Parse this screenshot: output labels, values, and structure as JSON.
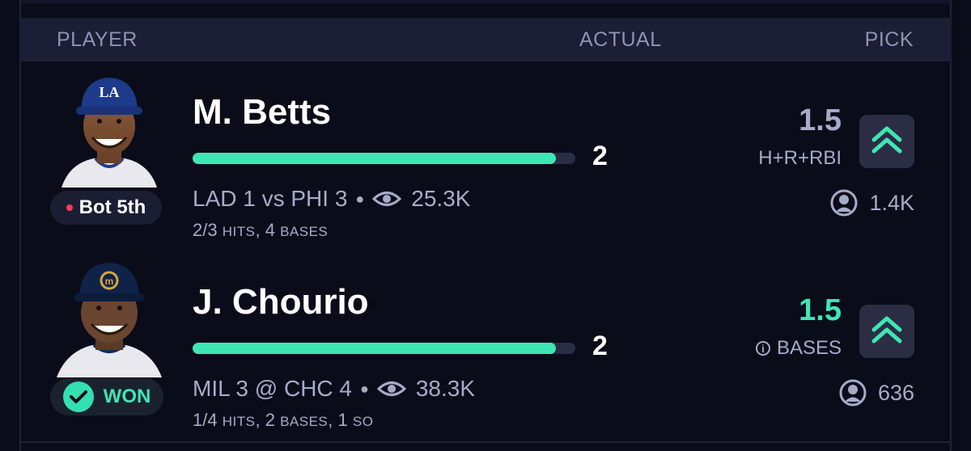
{
  "header": {
    "player": "PLAYER",
    "actual": "ACTUAL",
    "pick": "PICK"
  },
  "colors": {
    "accent": "#3ee6b4",
    "live_dot": "#ff3b5c",
    "background": "#0b0c19"
  },
  "rows": [
    {
      "name": "M. Betts",
      "status": "Bot 5th",
      "actual": "2",
      "progress": 0.95,
      "game": "LAD 1 vs PHI 3",
      "viewers": "25.3K",
      "stats_main": "2/3",
      "stats_rest": [
        {
          "label": "HITS",
          "sep": ", "
        },
        {
          "value": "4",
          "label": "BASES"
        }
      ],
      "line": "1.5",
      "stat_type": "H+R+RBI",
      "picks": "1.4K",
      "pick_icon": "chevron-double-up-icon"
    },
    {
      "name": "J. Chourio",
      "status": "WON",
      "actual": "2",
      "progress": 0.95,
      "game": "MIL 3 @ CHC 4",
      "viewers": "38.3K",
      "stats_main": "1/4",
      "stats_rest": [
        {
          "label": "HITS",
          "sep": ", "
        },
        {
          "value": "2",
          "label": "BASES",
          "sep": ", "
        },
        {
          "value": "1",
          "label": "SO"
        }
      ],
      "line": "1.5",
      "stat_type": "BASES",
      "picks": "636",
      "pick_icon": "chevron-double-up-icon"
    }
  ]
}
